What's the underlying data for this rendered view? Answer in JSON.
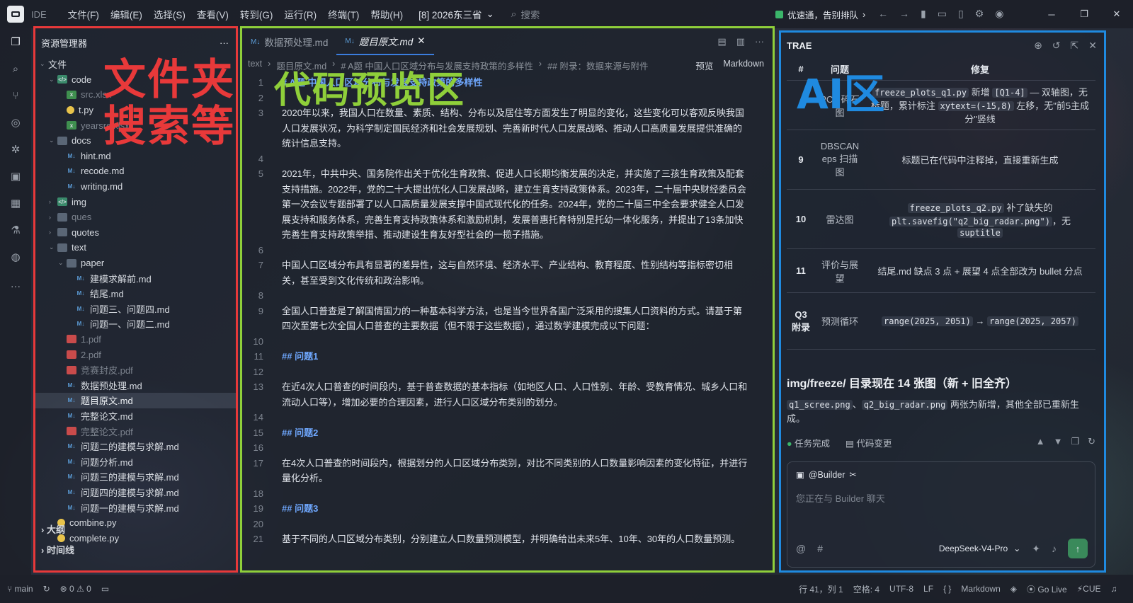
{
  "titlebar": {
    "ide_label": "IDE",
    "menu": [
      "文件(F)",
      "编辑(E)",
      "选择(S)",
      "查看(V)",
      "转到(G)",
      "运行(R)",
      "终端(T)",
      "帮助(H)"
    ],
    "workspace": "[8] 2026东三省",
    "search_placeholder": "搜索",
    "promo": "优速通，告别排队"
  },
  "explorer": {
    "title": "资源管理器",
    "annotation": "文件夹\n搜索等",
    "rows": [
      {
        "label": "文件",
        "indent": 0,
        "chev": "⌄",
        "icon": "",
        "cls": ""
      },
      {
        "label": "code",
        "indent": 1,
        "chev": "⌄",
        "icon": "code",
        "cls": ""
      },
      {
        "label": "src.xlsx",
        "indent": 2,
        "chev": "",
        "icon": "xls",
        "cls": "dim"
      },
      {
        "label": "t.py",
        "indent": 2,
        "chev": "",
        "icon": "py",
        "cls": ""
      },
      {
        "label": "yearsrc.xlsx",
        "indent": 2,
        "chev": "",
        "icon": "xls",
        "cls": "dim"
      },
      {
        "label": "docs",
        "indent": 1,
        "chev": "⌄",
        "icon": "folder",
        "cls": ""
      },
      {
        "label": "hint.md",
        "indent": 2,
        "chev": "",
        "icon": "md",
        "cls": ""
      },
      {
        "label": "recode.md",
        "indent": 2,
        "chev": "",
        "icon": "md",
        "cls": ""
      },
      {
        "label": "writing.md",
        "indent": 2,
        "chev": "",
        "icon": "md",
        "cls": ""
      },
      {
        "label": "img",
        "indent": 1,
        "chev": "›",
        "icon": "code",
        "cls": ""
      },
      {
        "label": "ques",
        "indent": 1,
        "chev": "›",
        "icon": "folder",
        "cls": "dim"
      },
      {
        "label": "quotes",
        "indent": 1,
        "chev": "›",
        "icon": "folder",
        "cls": ""
      },
      {
        "label": "text",
        "indent": 1,
        "chev": "⌄",
        "icon": "folder",
        "cls": ""
      },
      {
        "label": "paper",
        "indent": 2,
        "chev": "⌄",
        "icon": "folder",
        "cls": ""
      },
      {
        "label": "建模求解前.md",
        "indent": 3,
        "chev": "",
        "icon": "md",
        "cls": ""
      },
      {
        "label": "结尾.md",
        "indent": 3,
        "chev": "",
        "icon": "md",
        "cls": ""
      },
      {
        "label": "问题三、问题四.md",
        "indent": 3,
        "chev": "",
        "icon": "md",
        "cls": ""
      },
      {
        "label": "问题一、问题二.md",
        "indent": 3,
        "chev": "",
        "icon": "md",
        "cls": ""
      },
      {
        "label": "1.pdf",
        "indent": 2,
        "chev": "",
        "icon": "pdf",
        "cls": "dim"
      },
      {
        "label": "2.pdf",
        "indent": 2,
        "chev": "",
        "icon": "pdf",
        "cls": "dim"
      },
      {
        "label": "竞赛封皮.pdf",
        "indent": 2,
        "chev": "",
        "icon": "pdf",
        "cls": "dim"
      },
      {
        "label": "数据预处理.md",
        "indent": 2,
        "chev": "",
        "icon": "md",
        "cls": ""
      },
      {
        "label": "题目原文.md",
        "indent": 2,
        "chev": "",
        "icon": "md",
        "cls": "selected"
      },
      {
        "label": "完整论文.md",
        "indent": 2,
        "chev": "",
        "icon": "md",
        "cls": ""
      },
      {
        "label": "完整论文.pdf",
        "indent": 2,
        "chev": "",
        "icon": "pdf",
        "cls": "dim"
      },
      {
        "label": "问题二的建模与求解.md",
        "indent": 2,
        "chev": "",
        "icon": "md",
        "cls": ""
      },
      {
        "label": "问题分析.md",
        "indent": 2,
        "chev": "",
        "icon": "md",
        "cls": ""
      },
      {
        "label": "问题三的建模与求解.md",
        "indent": 2,
        "chev": "",
        "icon": "md",
        "cls": ""
      },
      {
        "label": "问题四的建模与求解.md",
        "indent": 2,
        "chev": "",
        "icon": "md",
        "cls": ""
      },
      {
        "label": "问题一的建模与求解.md",
        "indent": 2,
        "chev": "",
        "icon": "md",
        "cls": ""
      },
      {
        "label": "combine.py",
        "indent": 1,
        "chev": "",
        "icon": "py",
        "cls": ""
      },
      {
        "label": "complete.py",
        "indent": 1,
        "chev": "",
        "icon": "py",
        "cls": ""
      }
    ],
    "outline": "大纲",
    "timeline": "时间线"
  },
  "editor": {
    "tabs": [
      {
        "label": "数据预处理.md",
        "active": false
      },
      {
        "label": "题目原文.md",
        "active": true
      }
    ],
    "breadcrumb": [
      "text",
      "题目原文.md",
      "# A题 中国人口区域分布与发展支持政策的多样性",
      "## 附录：数据来源与附件"
    ],
    "preview": "预览",
    "language": "Markdown",
    "annotation": "代码预览区",
    "lines": [
      {
        "n": "1",
        "t": "# A题 中国人口区域分布与发展支持政策的多样性",
        "h": true
      },
      {
        "n": "2",
        "t": "",
        "h": false
      },
      {
        "n": "3",
        "t": "2020年以来，我国人口在数量、素质、结构、分布以及居住等方面发生了明显的变化，这些变化可以客观反映我国人口发展状况，为科学制定国民经济和社会发展规划、完善新时代人口发展战略、推动人口高质量发展提供准确的统计信息支持。",
        "h": false
      },
      {
        "n": "4",
        "t": "",
        "h": false
      },
      {
        "n": "5",
        "t": "2021年，中共中央、国务院作出关于优化生育政策、促进人口长期均衡发展的决定，并实施了三孩生育政策及配套支持措施。2022年，党的二十大提出优化人口发展战略，建立生育支持政策体系。2023年，二十届中央财经委员会第一次会议专题部署了以人口高质量发展支撑中国式现代化的任务。2024年，党的二十届三中全会要求健全人口发展支持和服务体系，完善生育支持政策体系和激励机制，发展普惠托育特别是托幼一体化服务，并提出了13条加快完善生育支持政策举措、推动建设生育友好型社会的一揽子措施。",
        "h": false
      },
      {
        "n": "6",
        "t": "",
        "h": false
      },
      {
        "n": "7",
        "t": "中国人口区域分布具有显著的差异性，这与自然环境、经济水平、产业结构、教育程度、性别结构等指标密切相关，甚至受到文化传统和政治影响。",
        "h": false
      },
      {
        "n": "8",
        "t": "",
        "h": false
      },
      {
        "n": "9",
        "t": "全国人口普查是了解国情国力的一种基本科学方法，也是当今世界各国广泛采用的搜集人口资料的方式。请基于第四次至第七次全国人口普查的主要数据（但不限于这些数据），通过数学建模完成以下问题：",
        "h": false
      },
      {
        "n": "10",
        "t": "",
        "h": false
      },
      {
        "n": "11",
        "t": "## 问题1",
        "h": true
      },
      {
        "n": "12",
        "t": "",
        "h": false
      },
      {
        "n": "13",
        "t": "在近4次人口普查的时间段内，基于普查数据的基本指标（如地区人口、人口性别、年龄、受教育情况、城乡人口和流动人口等），增加必要的合理因素，进行人口区域分布类别的划分。",
        "h": false
      },
      {
        "n": "14",
        "t": "",
        "h": false
      },
      {
        "n": "15",
        "t": "## 问题2",
        "h": true
      },
      {
        "n": "16",
        "t": "",
        "h": false
      },
      {
        "n": "17",
        "t": "在4次人口普查的时间段内，根据划分的人口区域分布类别，对比不同类别的人口数量影响因素的变化特征，并进行量化分析。",
        "h": false
      },
      {
        "n": "18",
        "t": "",
        "h": false
      },
      {
        "n": "19",
        "t": "## 问题3",
        "h": true
      },
      {
        "n": "20",
        "t": "",
        "h": false
      },
      {
        "n": "21",
        "t": "基于不同的人口区域分布类别，分别建立人口数量预测模型，并明确给出未来5年、10年、30年的人口数量预测。",
        "h": false
      }
    ]
  },
  "ai": {
    "title": "TRAE",
    "annotation": "AI区",
    "table_headers": [
      "#",
      "问题",
      "修复"
    ],
    "rows": [
      {
        "num": "8",
        "name": "PCA 碎石图",
        "fix": "<code>freeze_plots_q1.py</code> 新增 <code>[Q1-4]</code> — 双轴图，无标题，累计标注 <code>xytext=(-15,8)</code> 左移，无\"前5主成分\"竖线"
      },
      {
        "num": "9",
        "name": "DBSCAN eps 扫描图",
        "fix": "标题已在代码中注释掉，直接重新生成"
      },
      {
        "num": "10",
        "name": "雷达图",
        "fix": "<code>freeze_plots_q2.py</code> 补了缺失的 <code>plt.savefig(\"q2_big_radar.png\")</code>，无 <code>suptitle</code>"
      },
      {
        "num": "11",
        "name": "评价与展望",
        "fix": "结尾.md 缺点 3 点 + 展望 4 点全部改为 bullet 分点"
      },
      {
        "num": "Q3 附录",
        "name": "预测循环",
        "fix": "<code>range(2025, 2051)</code> → <code>range(2025, 2057)</code>"
      }
    ],
    "heading": "img/freeze/ 目录现在 14 张图（新 + 旧全齐）",
    "para_code1": "q1_scree.png",
    "para_sep": "、",
    "para_code2": "q2_big_radar.png",
    "para_text": " 两张为新增，其他全部已重新生成。",
    "status_done": "任务完成",
    "status_changes": "代码变更",
    "builder": "@Builder",
    "input_placeholder": "您正在与 Builder 聊天",
    "model": "DeepSeek-V4-Pro"
  },
  "statusbar": {
    "branch": "main",
    "errors": "0",
    "warnings": "0",
    "position": "行 41，列 1",
    "spaces": "空格: 4",
    "encoding": "UTF-8",
    "eol": "LF",
    "braces": "{ }",
    "language": "Markdown",
    "golive": "Go Live",
    "cue": "CUE"
  },
  "colors": {
    "explorer_border": "#e8393a",
    "editor_border": "#8fcf3a",
    "ai_border": "#1f8ae0"
  }
}
